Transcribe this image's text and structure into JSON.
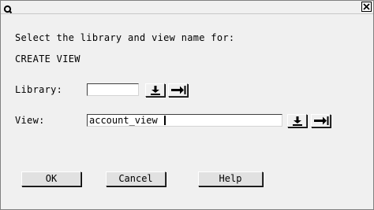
{
  "titlebar": {
    "app_icon": "q-app-icon",
    "close_icon": "close-x-icon"
  },
  "dialog": {
    "prompt_line1": "Select the library and view name for:",
    "prompt_line2": "CREATE VIEW"
  },
  "library": {
    "label": "Library:",
    "value": "",
    "dropdown_icon": "arrow-down-to-line-icon",
    "next_icon": "arrow-right-to-line-icon"
  },
  "view": {
    "label": "View:",
    "value": "account_view",
    "dropdown_icon": "arrow-down-to-line-icon",
    "next_icon": "arrow-right-to-line-icon"
  },
  "buttons": {
    "ok": "OK",
    "cancel": "Cancel",
    "help": "Help"
  },
  "colors": {
    "background": "#f0f0f0",
    "field_background": "#ffffff",
    "text": "#000000"
  }
}
